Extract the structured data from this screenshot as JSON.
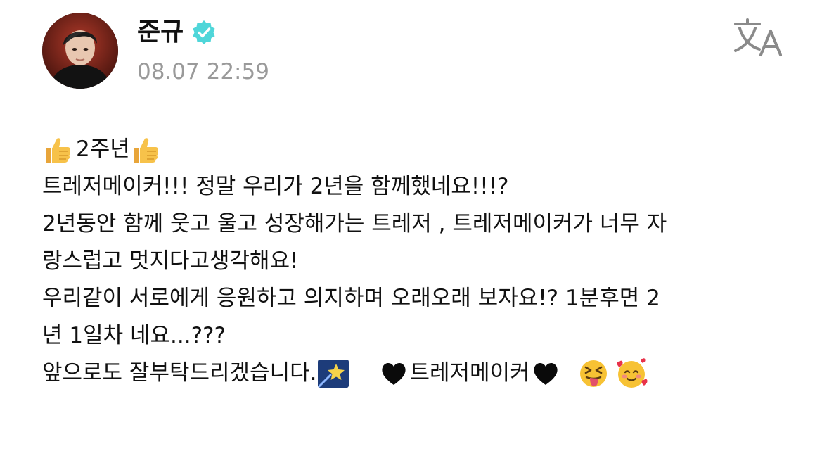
{
  "post": {
    "author_name": "준규",
    "timestamp": "08.07 22:59",
    "icons": {
      "verified": "verified-badge-icon",
      "translate": "translate-icon",
      "thumbs_up": "thumbs-up-emoji",
      "star": "shooting-star-emoji",
      "black_heart": "black-heart-emoji",
      "squint_tongue": "squinting-face-with-tongue-emoji",
      "smiling_hearts": "smiling-face-with-hearts-emoji"
    },
    "colors": {
      "verified": "#4fd6d9",
      "timestamp": "#9a9a9a",
      "text": "#111111"
    },
    "lines": {
      "l1": "2주년",
      "l2": "트레저메이커!!! 정말 우리가 2년을 함께했네요!!!?",
      "l3": "2년동안 함께 웃고 울고 성장해가는 트레저 , 트레저메이커가 너무 자",
      "l4": "랑스럽고 멋지다고생각해요!",
      "l5": "우리같이 서로에게 응원하고 의지하며 오래오래 보자요!? 1분후면 2",
      "l6": "년 1일차 네요...???",
      "l7a": "앞으로도 잘부탁드리겠습니다.",
      "l7b": "트레저메이커"
    }
  }
}
